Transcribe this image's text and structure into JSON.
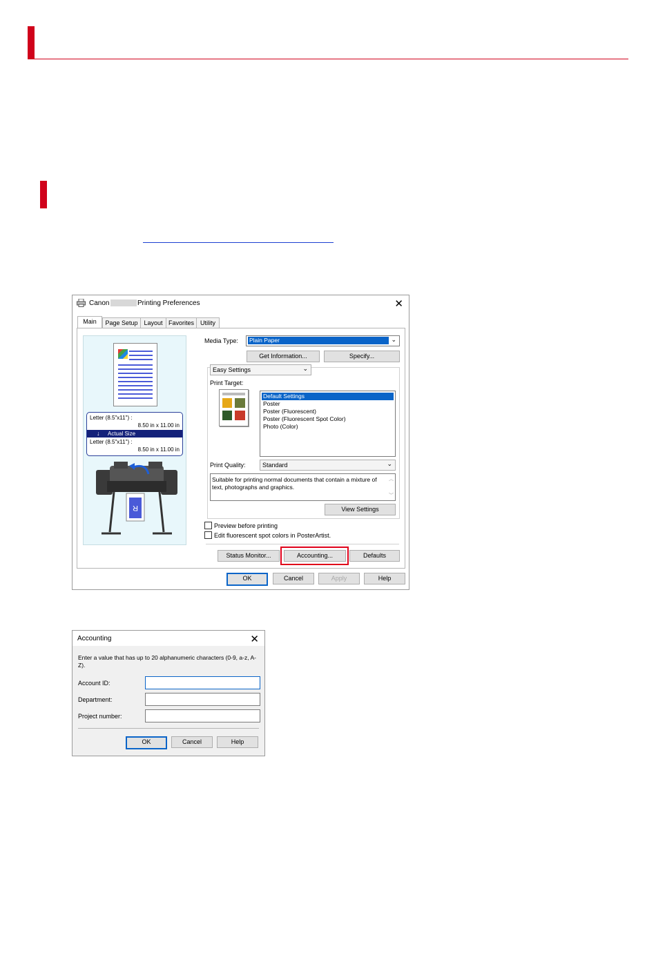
{
  "prefs_dialog": {
    "title_prefix": "Canon",
    "title_suffix": "Printing Preferences",
    "tabs": [
      "Main",
      "Page Setup",
      "Layout",
      "Favorites",
      "Utility"
    ],
    "paper_info": {
      "input_label": "Letter (8.5\"x11\") :",
      "input_size": "8.50 in x 11.00 in",
      "scaling": "Actual Size",
      "output_label": "Letter (8.5\"x11\") :",
      "output_size": "8.50 in x 11.00 in"
    },
    "media_type_label": "Media Type:",
    "media_type_value": "Plain Paper",
    "get_information_button": "Get Information...",
    "specify_button": "Specify...",
    "mode_value": "Easy Settings",
    "print_target_label": "Print Target:",
    "print_targets": [
      "Default Settings",
      "Poster",
      "Poster (Fluorescent)",
      "Poster (Fluorescent Spot Color)",
      "Photo (Color)"
    ],
    "print_quality_label": "Print Quality:",
    "print_quality_value": "Standard",
    "description": "Suitable for printing normal documents that contain a mixture of text, photographs and graphics.",
    "view_settings_button": "View Settings",
    "preview_checkbox": "Preview before printing",
    "fluorescent_checkbox": "Edit fluorescent spot colors in PosterArtist.",
    "status_monitor_button": "Status Monitor...",
    "accounting_button": "Accounting...",
    "defaults_button": "Defaults",
    "ok_button": "OK",
    "cancel_button": "Cancel",
    "apply_button": "Apply",
    "help_button": "Help"
  },
  "accounting_dialog": {
    "title": "Accounting",
    "instruction": "Enter a value that has up to 20 alphanumeric characters (0-9, a-z, A-Z).",
    "account_id_label": "Account ID:",
    "department_label": "Department:",
    "project_number_label": "Project number:",
    "ok_button": "OK",
    "cancel_button": "Cancel",
    "help_button": "Help"
  },
  "colors": {
    "accent_red": "#d0021b",
    "selection_blue": "#0a64c8",
    "highlight_box": "#e0001a"
  }
}
